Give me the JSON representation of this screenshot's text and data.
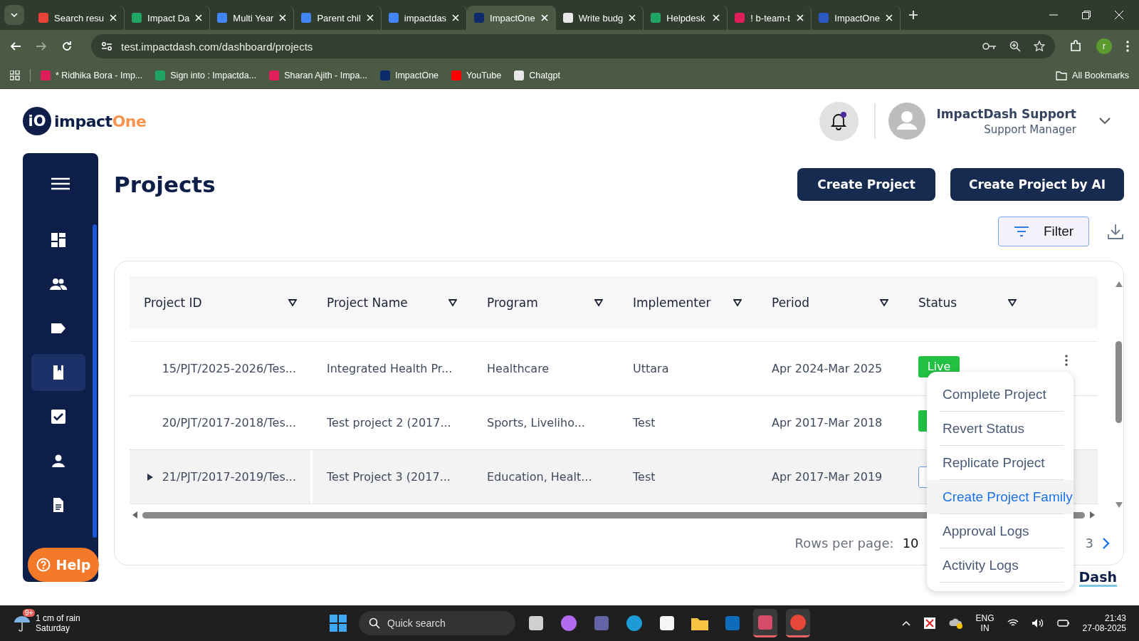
{
  "browser": {
    "tabs": [
      {
        "title": "Search resu",
        "kind": "mail",
        "selected": false
      },
      {
        "title": "Impact Da",
        "kind": "sheet",
        "selected": false
      },
      {
        "title": "Multi Year",
        "kind": "doc",
        "selected": false
      },
      {
        "title": "Parent chil",
        "kind": "doc",
        "selected": false
      },
      {
        "title": "impactdas",
        "kind": "calendar",
        "selected": false
      },
      {
        "title": "ImpactOne",
        "kind": "brand",
        "selected": true
      },
      {
        "title": "Write budg",
        "kind": "spiral",
        "selected": false
      },
      {
        "title": "Helpdesk",
        "kind": "headset",
        "selected": false
      },
      {
        "title": "! b-team-t",
        "kind": "grid",
        "selected": false
      },
      {
        "title": "ImpactOne",
        "kind": "brand-small",
        "selected": false
      }
    ],
    "address": "test.impactdash.com/dashboard/projects",
    "profile": "r",
    "bookmarks": [
      {
        "title": "* Ridhika Bora - Imp...",
        "kind": "grid"
      },
      {
        "title": "Sign into : Impactda...",
        "kind": "headset"
      },
      {
        "title": "Sharan Ajith - Impa...",
        "kind": "grid"
      },
      {
        "title": "ImpactOne",
        "kind": "brand"
      },
      {
        "title": "YouTube",
        "kind": "play"
      },
      {
        "title": "Chatgpt",
        "kind": "spiral"
      }
    ],
    "all_bookmarks": "All Bookmarks"
  },
  "header": {
    "logo": {
      "mark": "iO",
      "word": "impact",
      "accent": "One"
    },
    "notifications": {
      "unread": true
    },
    "user": {
      "name": "ImpactDash Support",
      "role": "Support Manager"
    }
  },
  "sidebar": {
    "items": [
      {
        "kind": "dashboard",
        "selected": false
      },
      {
        "kind": "people",
        "selected": false
      },
      {
        "kind": "label",
        "selected": false
      },
      {
        "kind": "book",
        "selected": true
      },
      {
        "kind": "check",
        "selected": false
      },
      {
        "kind": "person",
        "selected": false
      },
      {
        "kind": "document",
        "selected": false
      }
    ],
    "help": "Help"
  },
  "page": {
    "title": "Projects",
    "buttons": [
      "Create Project",
      "Create Project by AI"
    ],
    "filter": "Filter"
  },
  "table": {
    "columns": [
      "Project ID",
      "Project Name",
      "Program",
      "Implementer",
      "Period",
      "Status"
    ],
    "rows": [
      {
        "cells": [
          "15/PJT/2025-2026/Tes...",
          "Integrated Health Pr...",
          "Healthcare",
          "Uttara",
          "Apr 2024-Mar 2025"
        ],
        "status": {
          "kind": "live",
          "label": "Live"
        },
        "expandable": false,
        "selected": false,
        "menu": true
      },
      {
        "cells": [
          "20/PJT/2017-2018/Tes...",
          "Test project 2 (2017...",
          "Sports, Liveliho...",
          "Test",
          "Apr 2017-Mar 2018"
        ],
        "status": {
          "kind": "live"
        },
        "expandable": false,
        "selected": false
      },
      {
        "cells": [
          "21/PJT/2017-2019/Tes...",
          "Test Project 3 (2017...",
          "Education, Healt...",
          "Test",
          "Apr 2017-Mar 2019"
        ],
        "status": {
          "kind": "outline"
        },
        "expandable": true,
        "selected": true
      }
    ],
    "pagination": {
      "label": "Rows per page:",
      "value": "10",
      "page": "3"
    }
  },
  "context_menu": [
    {
      "label": "Complete Project",
      "selected": false
    },
    {
      "label": "Revert Status",
      "selected": false
    },
    {
      "label": "Replicate Project",
      "selected": false
    },
    {
      "label": "Create Project Family",
      "selected": true
    },
    {
      "label": "Approval Logs",
      "selected": false
    },
    {
      "label": "Activity Logs",
      "selected": false
    }
  ],
  "footer": {
    "brand": "Dash"
  },
  "taskbar": {
    "weather": {
      "badge": "9+",
      "line1": "1 cm of rain",
      "line2": "Saturday"
    },
    "search": "Quick search",
    "apps": [
      {
        "kind": "windows",
        "selected": false
      },
      {
        "kind": "files",
        "selected": false
      },
      {
        "kind": "copilot",
        "selected": false
      },
      {
        "kind": "teams",
        "selected": false
      },
      {
        "kind": "edge",
        "selected": false
      },
      {
        "kind": "store",
        "selected": false
      },
      {
        "kind": "folder",
        "selected": false
      },
      {
        "kind": "outlook",
        "selected": false
      },
      {
        "kind": "arrow",
        "selected": true
      },
      {
        "kind": "chrome",
        "selected": true
      }
    ],
    "lang": "ENG",
    "region": "IN",
    "time": "21:43",
    "date": "27-08-2025"
  }
}
